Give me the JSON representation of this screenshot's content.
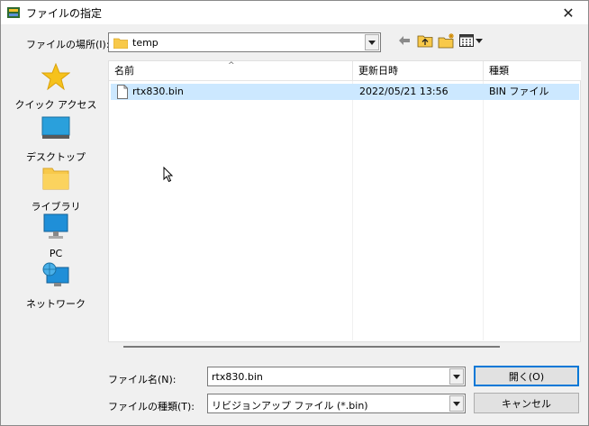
{
  "window": {
    "title": "ファイルの指定",
    "close_glyph": "✕"
  },
  "lookin": {
    "label": "ファイルの場所(I):",
    "value": "temp"
  },
  "places": [
    {
      "label": "クイック アクセス",
      "icon": "star-icon"
    },
    {
      "label": "デスクトップ",
      "icon": "desktop-icon"
    },
    {
      "label": "ライブラリ",
      "icon": "library-folder-icon"
    },
    {
      "label": "PC",
      "icon": "monitor-icon"
    },
    {
      "label": "ネットワーク",
      "icon": "network-icon"
    }
  ],
  "list": {
    "columns": [
      "名前",
      "更新日時",
      "種類"
    ],
    "sort_glyph": "^",
    "rows": [
      {
        "name": "rtx830.bin",
        "modified": "2022/05/21 13:56",
        "type": "BIN ファイル"
      }
    ]
  },
  "filename": {
    "label": "ファイル名(N):",
    "value": "rtx830.bin"
  },
  "filetype": {
    "label": "ファイルの種類(T):",
    "value": "リビジョンアップ ファイル (*.bin)"
  },
  "buttons": {
    "open": "開く(O)",
    "cancel": "キャンセル"
  },
  "colors": {
    "selection": "#cce8ff",
    "default_border": "#0078d7",
    "folder": "#f8c94a"
  }
}
